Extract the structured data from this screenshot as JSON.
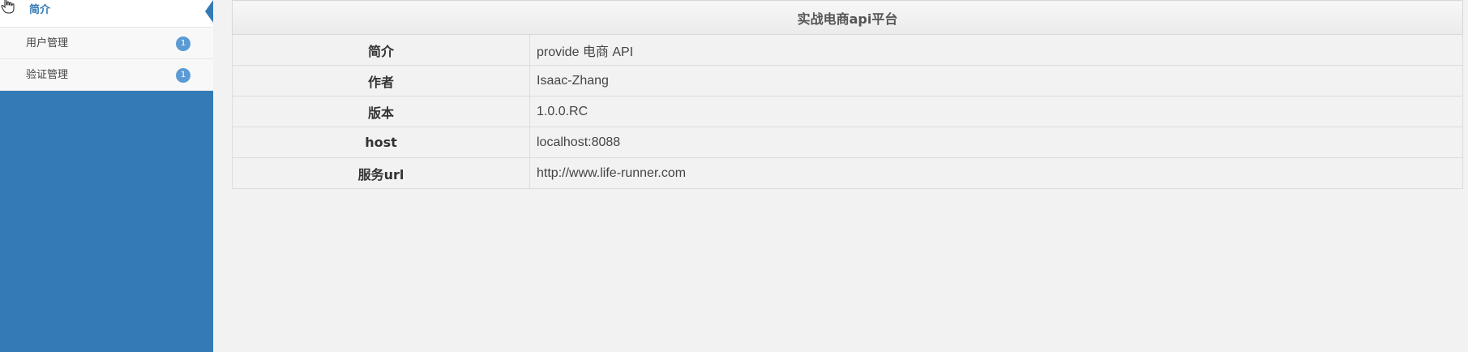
{
  "sidebar": {
    "items": [
      {
        "label": "简介",
        "active": true,
        "badge": ""
      },
      {
        "label": "用户管理",
        "active": false,
        "badge": "1"
      },
      {
        "label": "验证管理",
        "active": false,
        "badge": "1"
      }
    ],
    "background_color": "#337ab7"
  },
  "main": {
    "title": "实战电商api平台",
    "rows": [
      {
        "key": "简介",
        "value": "provide 电商 API"
      },
      {
        "key": "作者",
        "value": "Isaac-Zhang"
      },
      {
        "key": "版本",
        "value": "1.0.0.RC"
      },
      {
        "key": "host",
        "value": "localhost:8088"
      },
      {
        "key": "服务url",
        "value": "http://www.life-runner.com"
      }
    ]
  },
  "icons": {
    "cursor": "hand-pointer-icon"
  }
}
